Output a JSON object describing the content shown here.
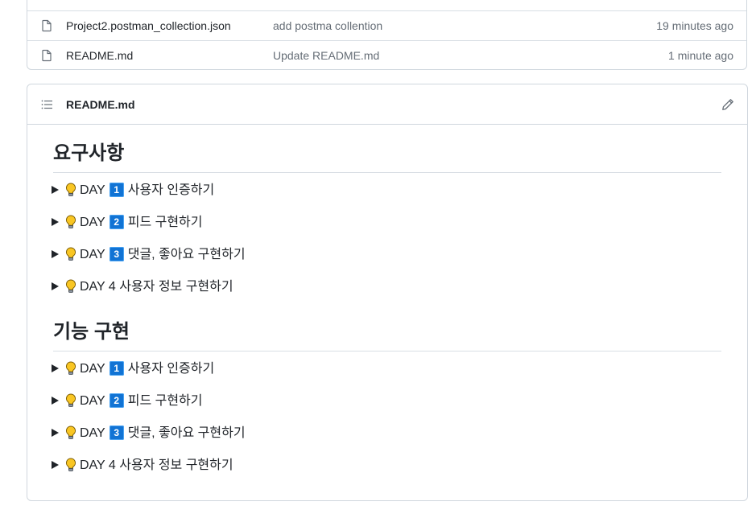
{
  "files": [
    {
      "name": "Project2.postman_collection.json",
      "message": "add postma collention",
      "age": "19 minutes ago"
    },
    {
      "name": "README.md",
      "message": "Update README.md",
      "age": "1 minute ago"
    }
  ],
  "readme": {
    "filename": "README.md",
    "sections": [
      {
        "heading": "요구사항",
        "items": [
          {
            "day": "DAY",
            "num": "1",
            "text": "사용자 인증하기"
          },
          {
            "day": "DAY",
            "num": "2",
            "text": "피드 구현하기"
          },
          {
            "day": "DAY",
            "num": "3",
            "text": "댓글, 좋아요 구현하기"
          },
          {
            "day": "DAY 4",
            "num": "",
            "text": "사용자 정보 구현하기"
          }
        ]
      },
      {
        "heading": "기능 구현",
        "items": [
          {
            "day": "DAY",
            "num": "1",
            "text": "사용자 인증하기"
          },
          {
            "day": "DAY",
            "num": "2",
            "text": "피드 구현하기"
          },
          {
            "day": "DAY",
            "num": "3",
            "text": "댓글, 좋아요 구현하기"
          },
          {
            "day": "DAY 4",
            "num": "",
            "text": "사용자 정보 구현하기"
          }
        ]
      }
    ]
  },
  "icons": {
    "file": "file-icon",
    "toc": "list-unordered-icon",
    "edit": "pencil-icon",
    "bulb": "light-bulb-icon"
  },
  "colors": {
    "border": "#d0d7de",
    "muted": "#656d76",
    "keycap": "#1173d4",
    "bulb": "#f9c623"
  }
}
